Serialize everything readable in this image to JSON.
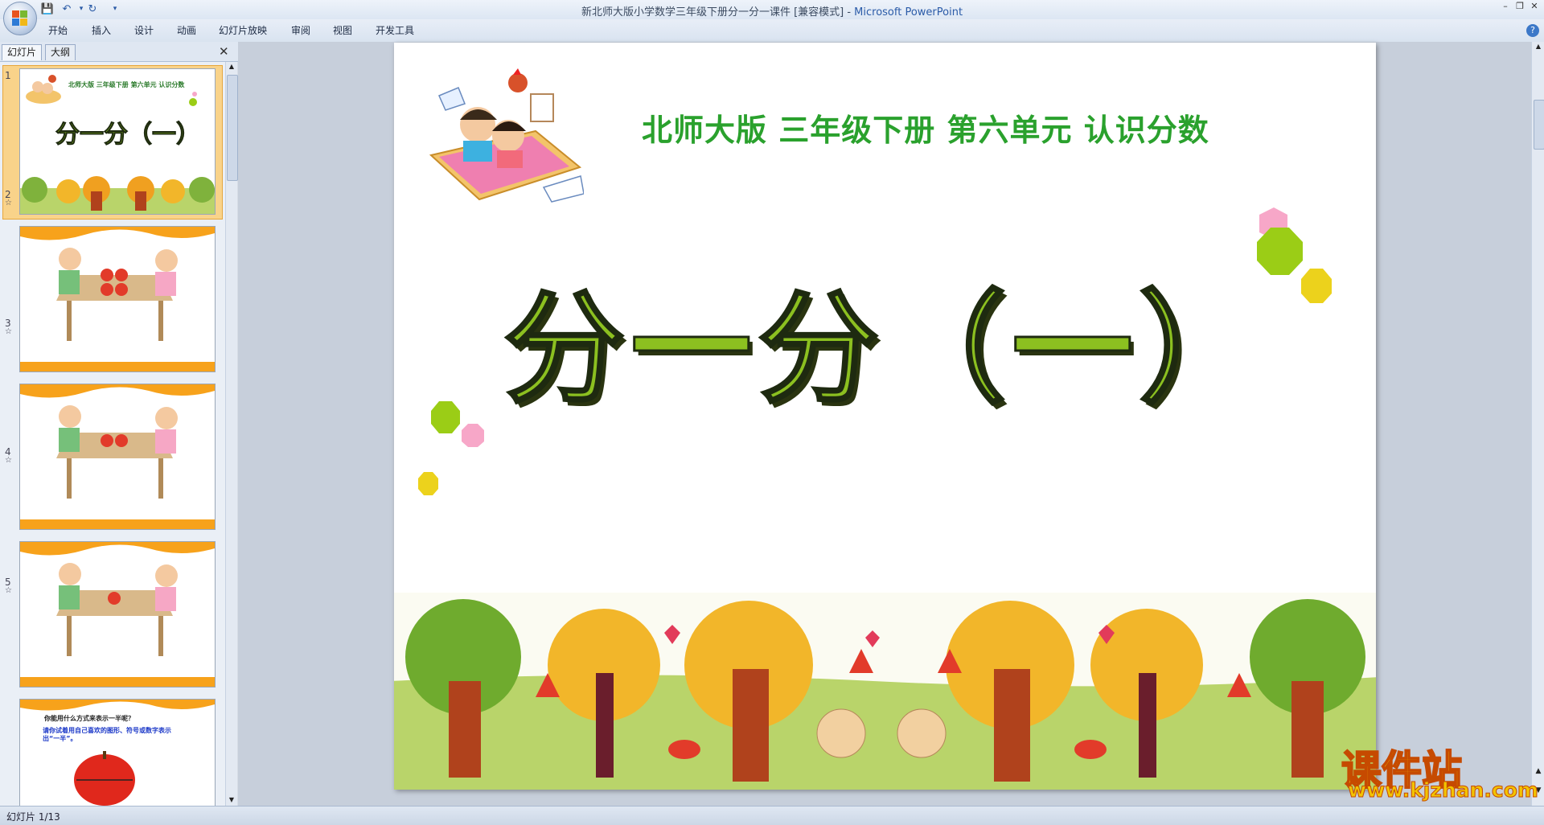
{
  "window": {
    "title_doc": "新北师大版小学数学三年级下册分一分一课件 [兼容模式] - ",
    "title_app": "Microsoft PowerPoint"
  },
  "ribbon": {
    "tabs": [
      {
        "label": "开始"
      },
      {
        "label": "插入"
      },
      {
        "label": "设计"
      },
      {
        "label": "动画"
      },
      {
        "label": "幻灯片放映"
      },
      {
        "label": "审阅"
      },
      {
        "label": "视图"
      },
      {
        "label": "开发工具"
      }
    ]
  },
  "left_pane": {
    "tab_slides": "幻灯片",
    "tab_outline": "大纲",
    "thumbnails": [
      {
        "num": "1",
        "sub": "北师大版  三年级下册  第六单元  认识分数",
        "title": "分一分（一）"
      },
      {
        "num": "2"
      },
      {
        "num": "3"
      },
      {
        "num": "4"
      },
      {
        "num": "5",
        "q1": "你能用什么方式来表示一半呢？",
        "q2": "请你试着用自己喜欢的图形、符号或数字表示出“一半”。"
      }
    ]
  },
  "slide": {
    "subtitle": "北师大版  三年级下册  第六单元  认识分数",
    "title": "分一分（一）"
  },
  "status": {
    "slide_counter": "幻灯片 1/13"
  },
  "watermark": {
    "cn": "课件站",
    "url": "www.kjzhan.com"
  },
  "colors": {
    "title_green": "#8cc020",
    "subtitle_green": "#2aa12d",
    "thumb_orange": "#f7a21b"
  }
}
